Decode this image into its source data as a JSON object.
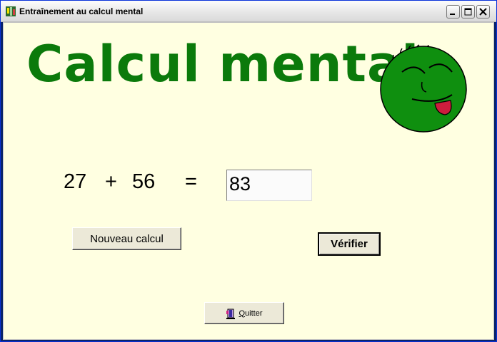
{
  "window": {
    "title": "Entraînement au calcul mental"
  },
  "heading": "Calcul mental",
  "exercise": {
    "operand1": "27",
    "operator": "+",
    "operand2": "56",
    "equals": "=",
    "answer": "83"
  },
  "buttons": {
    "new": "Nouveau calcul",
    "check": "Vérifier",
    "quit_first": "Q",
    "quit_rest": "uitter"
  },
  "icons": {
    "app": "tree-app-icon",
    "mascot": "green-smiley-face",
    "quit": "door-exit-icon"
  },
  "colors": {
    "title": "#0b7a0b",
    "background": "#ffffe1",
    "smiley": "#0f8f0f"
  }
}
